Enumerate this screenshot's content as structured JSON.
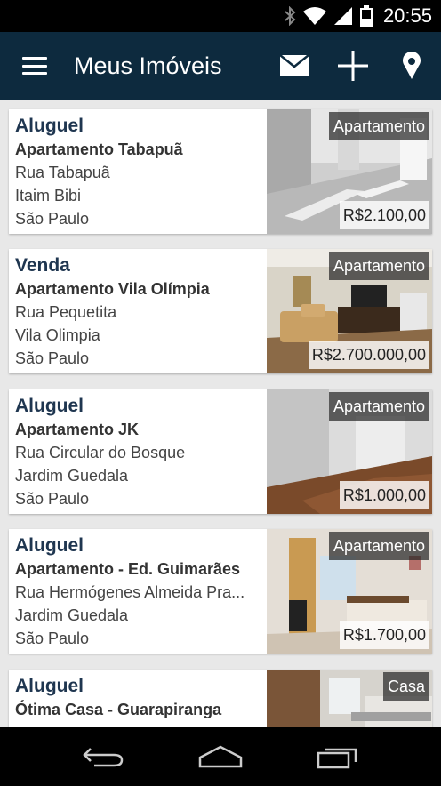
{
  "status_bar": {
    "time": "20:55",
    "icons": [
      "bluetooth-icon",
      "wifi-icon",
      "signal-icon",
      "battery-icon"
    ]
  },
  "action_bar": {
    "title": "Meus Imóveis",
    "icons": [
      "menu-icon",
      "mail-icon",
      "add-icon",
      "location-pin-icon"
    ],
    "color": "#0d2a3e"
  },
  "listings": [
    {
      "deal": "Aluguel",
      "title": "Apartamento Tabapuã",
      "street": "Rua Tabapuã",
      "district": "Itaim Bibi",
      "city": "São Paulo",
      "kind": "Apartamento",
      "price": "R$2.100,00"
    },
    {
      "deal": "Venda",
      "title": "Apartamento Vila Olímpia",
      "street": "Rua Pequetita",
      "district": "Vila Olimpia",
      "city": "São Paulo",
      "kind": "Apartamento",
      "price": "R$2.700.000,00"
    },
    {
      "deal": "Aluguel",
      "title": "Apartamento JK",
      "street": "Rua Circular do Bosque",
      "district": "Jardim Guedala",
      "city": "São Paulo",
      "kind": "Apartamento",
      "price": "R$1.000,00"
    },
    {
      "deal": "Aluguel",
      "title": "Apartamento - Ed. Guimarães",
      "street": "Rua Hermógenes Almeida Pra...",
      "district": "Jardim Guedala",
      "city": "São Paulo",
      "kind": "Apartamento",
      "price": "R$1.700,00"
    },
    {
      "deal": "Aluguel",
      "title": "Ótima Casa - Guarapiranga",
      "street": "",
      "district": "",
      "city": "",
      "kind": "Casa",
      "price": ""
    }
  ],
  "nav_bar": {
    "icons": [
      "back-icon",
      "home-icon",
      "recent-apps-icon"
    ]
  }
}
